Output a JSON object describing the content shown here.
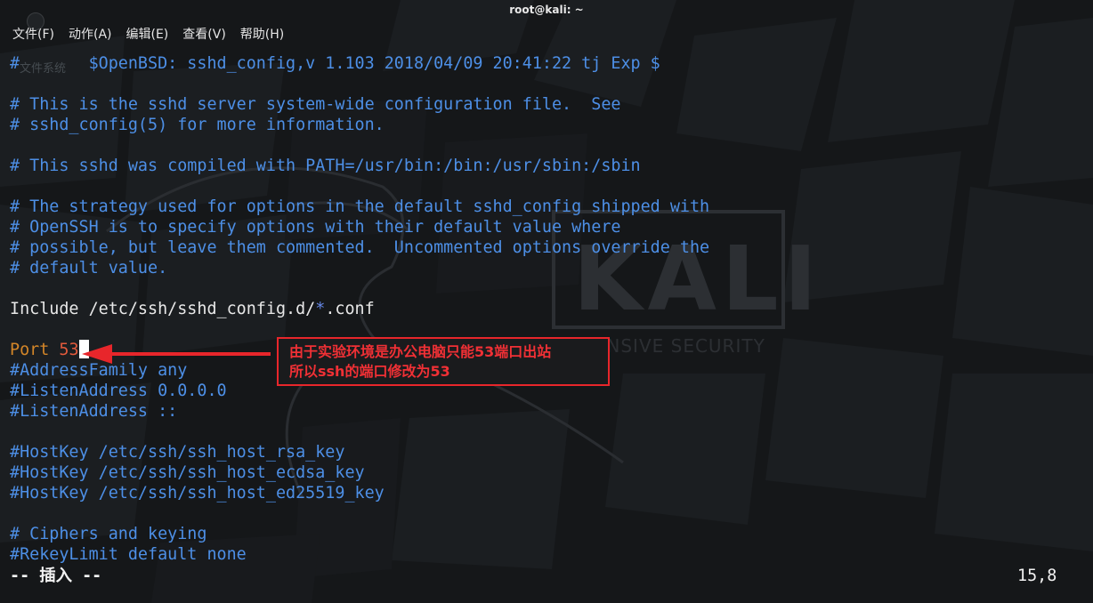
{
  "window": {
    "title": "root@kali: ~"
  },
  "menu": [
    "文件(F)",
    "动作(A)",
    "编辑(E)",
    "查看(V)",
    "帮助(H)"
  ],
  "background": {
    "ghost_label": "文件系统",
    "logo_text": "KALI",
    "logo_subtext": "OFFENSIVE SECURITY"
  },
  "editor": {
    "lines": [
      [
        {
          "t": "#       $OpenBSD: sshd_config,v 1.103 2018/04/09 20:41:22 tj Exp $",
          "c": "comment"
        }
      ],
      [],
      [
        {
          "t": "# This is the sshd server system-wide configuration file.  See",
          "c": "comment"
        }
      ],
      [
        {
          "t": "# sshd_config(5) for more information.",
          "c": "comment"
        }
      ],
      [],
      [
        {
          "t": "# This sshd was compiled with PATH=/usr/bin:/bin:/usr/sbin:/sbin",
          "c": "comment"
        }
      ],
      [],
      [
        {
          "t": "# The strategy used for options in the default sshd_config shipped with",
          "c": "comment"
        }
      ],
      [
        {
          "t": "# OpenSSH is to specify options with their default value where",
          "c": "comment"
        }
      ],
      [
        {
          "t": "# possible, but leave them commented.  Uncommented options override the",
          "c": "comment"
        }
      ],
      [
        {
          "t": "# default value.",
          "c": "comment"
        }
      ],
      [],
      [
        {
          "t": "Include /etc/ssh/sshd_config.d/",
          "c": "text"
        },
        {
          "t": "*",
          "c": "star"
        },
        {
          "t": ".conf",
          "c": "text"
        }
      ],
      [],
      [
        {
          "t": "Port ",
          "c": "keyword"
        },
        {
          "t": "53",
          "c": "number"
        },
        {
          "t": "",
          "c": "cursor"
        }
      ],
      [
        {
          "t": "#AddressFamily any",
          "c": "comment"
        }
      ],
      [
        {
          "t": "#ListenAddress 0.0.0.0",
          "c": "comment"
        }
      ],
      [
        {
          "t": "#ListenAddress ::",
          "c": "comment"
        }
      ],
      [],
      [
        {
          "t": "#HostKey /etc/ssh/ssh_host_rsa_key",
          "c": "comment"
        }
      ],
      [
        {
          "t": "#HostKey /etc/ssh/ssh_host_ecdsa_key",
          "c": "comment"
        }
      ],
      [
        {
          "t": "#HostKey /etc/ssh/ssh_host_ed25519_key",
          "c": "comment"
        }
      ],
      [],
      [
        {
          "t": "# Ciphers and keying",
          "c": "comment"
        }
      ],
      [
        {
          "t": "#RekeyLimit default none",
          "c": "comment"
        }
      ]
    ]
  },
  "status": {
    "mode": "-- 插入 --",
    "position": "15,8"
  },
  "annotation": {
    "line1": "由于实验环境是办公电脑只能53端口出站",
    "line2": "所以ssh的端口修改为53",
    "color": "#e8262b"
  },
  "colors": {
    "background": "#151719",
    "comment": "#4d8fe6",
    "keyword": "#d48628",
    "number": "#e25a3c"
  }
}
